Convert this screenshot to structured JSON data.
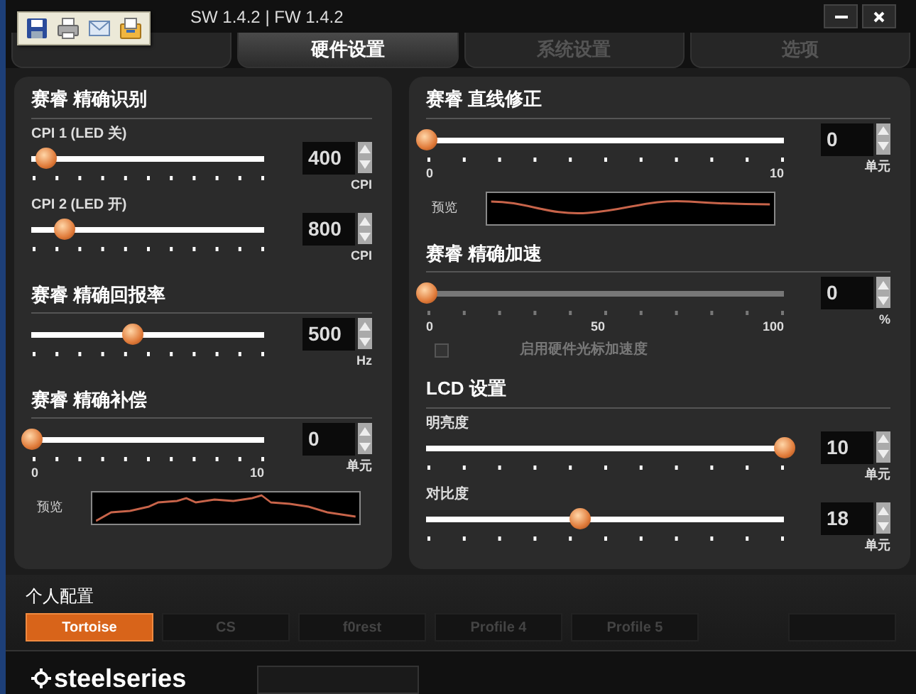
{
  "window": {
    "version": "SW 1.4.2 | FW 1.4.2"
  },
  "tabs": [
    {
      "selected": false
    },
    {
      "label": "硬件设置",
      "selected": true
    },
    {
      "label": "系统设置",
      "selected": false
    },
    {
      "label": "选项",
      "selected": false
    }
  ],
  "left_panel": [
    {
      "title": "赛睿 精确识别",
      "sliders": [
        {
          "label": "CPI 1 (LED 关)",
          "level": 0.06,
          "value": "400",
          "unit": "CPI"
        },
        {
          "label": "CPI 2 (LED 开)",
          "level": 0.14,
          "value": "800",
          "unit": "CPI"
        }
      ]
    },
    {
      "title": "赛睿 精确回报率",
      "sliders": [
        {
          "level": 0.43,
          "value": "500",
          "unit": "Hz"
        }
      ]
    },
    {
      "title": "赛睿 精确补偿",
      "sliders": [
        {
          "level": 0,
          "value": "0",
          "unit": "单元",
          "tick_labels": [
            "0",
            "10"
          ]
        }
      ],
      "preview": {
        "label": "预览",
        "kind": "jagged"
      }
    }
  ],
  "right_panel": [
    {
      "title": "赛睿 直线修正",
      "sliders": [
        {
          "level": 0,
          "value": "0",
          "unit": "单元",
          "tick_labels": [
            "0",
            "10"
          ]
        }
      ],
      "preview": {
        "label": "预览",
        "kind": "wave"
      }
    },
    {
      "title": "赛睿 精确加速",
      "sliders": [
        {
          "level": 0,
          "value": "0",
          "unit": "%",
          "tick_labels": [
            "0",
            "50",
            "100"
          ],
          "disabled": true
        }
      ],
      "checkbox": {
        "label": "启用硬件光标加速度",
        "checked": false,
        "disabled": true
      }
    },
    {
      "title": "LCD 设置",
      "sliders": [
        {
          "label": "明亮度",
          "level": 1,
          "value": "10",
          "unit": "单元"
        },
        {
          "label": "对比度",
          "level": 0.43,
          "value": "18",
          "unit": "单元"
        }
      ]
    }
  ],
  "profiles": {
    "title": "个人配置",
    "items": [
      {
        "label": "Tortoise",
        "selected": true
      },
      {
        "label": "CS",
        "selected": false
      },
      {
        "label": "f0rest",
        "selected": false
      },
      {
        "label": "Profile 4",
        "selected": false
      },
      {
        "label": "Profile 5",
        "selected": false
      }
    ]
  },
  "footer": {
    "logo": "steelseries"
  }
}
